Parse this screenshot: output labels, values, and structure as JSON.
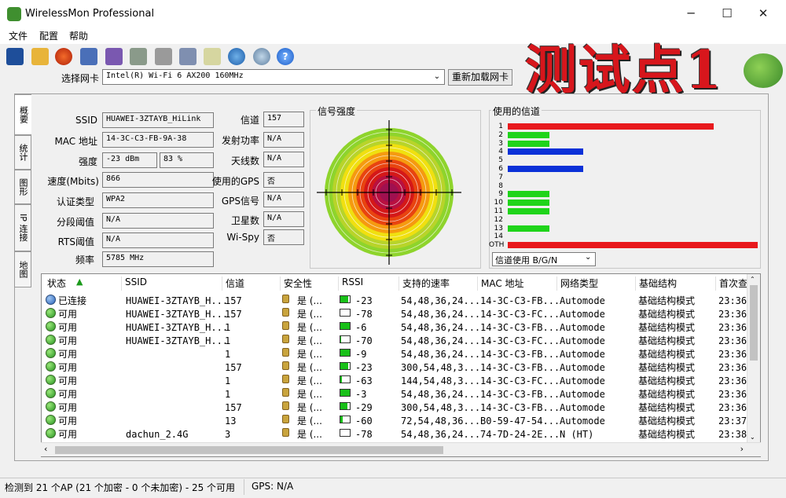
{
  "window": {
    "title": "WirelessMon Professional",
    "minimize": "─",
    "maximize": "☐",
    "close": "✕"
  },
  "menu": [
    "文件",
    "配置",
    "帮助"
  ],
  "toolbar_icons": [
    "save-icon",
    "open-folder-icon",
    "record-icon",
    "network-icon",
    "network-alt-icon",
    "export-icon",
    "print-icon",
    "settings-icon",
    "clipboard-icon",
    "globe-icon",
    "connect-icon",
    "help-icon"
  ],
  "nic": {
    "label": "选择网卡",
    "value": "Intel(R) Wi-Fi 6 AX200 160MHz",
    "reload": "重新加载网卡"
  },
  "overlay_title": "测试点1",
  "side_tabs": [
    "概要",
    "统计",
    "图形",
    "IP 连接",
    "地图"
  ],
  "fields": {
    "ssid": {
      "label": "SSID",
      "value": "HUAWEI-3ZTAYB_HiLink"
    },
    "mac": {
      "label": "MAC 地址",
      "value": "14-3C-C3-FB-9A-38"
    },
    "strength": {
      "label": "强度",
      "value": "-23 dBm",
      "pct": "83 %"
    },
    "speed": {
      "label": "速度(Mbits)",
      "value": "866"
    },
    "auth": {
      "label": "认证类型",
      "value": "WPA2"
    },
    "frag": {
      "label": "分段阈值",
      "value": "N/A"
    },
    "rts": {
      "label": "RTS阈值",
      "value": "N/A"
    },
    "freq": {
      "label": "频率",
      "value": "5785 MHz"
    },
    "channel": {
      "label": "信道",
      "value": "157"
    },
    "txpower": {
      "label": "发射功率",
      "value": "N/A"
    },
    "antennas": {
      "label": "天线数",
      "value": "N/A"
    },
    "use_gps": {
      "label": "使用的GPS",
      "value": "否"
    },
    "gps_signal": {
      "label": "GPS信号",
      "value": "N/A"
    },
    "satellites": {
      "label": "卫星数",
      "value": "N/A"
    },
    "wispy": {
      "label": "Wi-Spy",
      "value": "否"
    }
  },
  "signal": {
    "title": "信号强度"
  },
  "channels": {
    "title": "使用的信道",
    "labels": [
      "1",
      "2",
      "3",
      "4",
      "5",
      "6",
      "7",
      "8",
      "9",
      "10",
      "11",
      "12",
      "13",
      "14",
      "OTH"
    ],
    "usage": [
      5,
      1,
      1,
      2,
      0,
      2,
      0,
      0,
      1,
      1,
      1,
      0,
      1,
      0,
      6
    ],
    "colors": [
      "#e8191d",
      "#1fd41a",
      "#1fd41a",
      "#0b31d8",
      "#ffffff",
      "#0b31d8",
      "#ffffff",
      "#ffffff",
      "#1fd41a",
      "#1fd41a",
      "#1fd41a",
      "#ffffff",
      "#1fd41a",
      "#ffffff",
      "#e8191d"
    ],
    "select": "信道使用 B/G/N"
  },
  "table": {
    "headers": [
      "状态",
      "SSID",
      "信道",
      "安全性",
      "RSSI",
      "支持的速率",
      "MAC 地址",
      "网络类型",
      "基础结构",
      "首次查"
    ],
    "rows": [
      {
        "status": "已连接",
        "ssid": "HUAWEI-3ZTAYB_H...",
        "channel": "157",
        "sec": "是 (...",
        "rssi": "-23",
        "fill": 0.83,
        "rates": "54,48,36,24...",
        "mac": "14-3C-C3-FB...",
        "type": "Automode",
        "infra": "基础结构模式",
        "first": "23:36:"
      },
      {
        "status": "可用",
        "ssid": "HUAWEI-3ZTAYB_H...",
        "channel": "157",
        "sec": "是 (...",
        "rssi": "-78",
        "fill": 0,
        "rates": "54,48,36,24...",
        "mac": "14-3C-C3-FC...",
        "type": "Automode",
        "infra": "基础结构模式",
        "first": "23:36:"
      },
      {
        "status": "可用",
        "ssid": "HUAWEI-3ZTAYB_H...",
        "channel": "1",
        "sec": "是 (...",
        "rssi": "-6",
        "fill": 1,
        "rates": "54,48,36,24...",
        "mac": "14-3C-C3-FB...",
        "type": "Automode",
        "infra": "基础结构模式",
        "first": "23:36:"
      },
      {
        "status": "可用",
        "ssid": "HUAWEI-3ZTAYB_H...",
        "channel": "1",
        "sec": "是 (...",
        "rssi": "-70",
        "fill": 0.1,
        "rates": "54,48,36,24...",
        "mac": "14-3C-C3-FC...",
        "type": "Automode",
        "infra": "基础结构模式",
        "first": "23:36:"
      },
      {
        "status": "可用",
        "ssid": "",
        "channel": "1",
        "sec": "是 (...",
        "rssi": "-9",
        "fill": 1,
        "rates": "54,48,36,24...",
        "mac": "14-3C-C3-FB...",
        "type": "Automode",
        "infra": "基础结构模式",
        "first": "23:36:"
      },
      {
        "status": "可用",
        "ssid": "",
        "channel": "157",
        "sec": "是 (...",
        "rssi": "-23",
        "fill": 0.83,
        "rates": "300,54,48,3...",
        "mac": "14-3C-C3-FB...",
        "type": "Automode",
        "infra": "基础结构模式",
        "first": "23:36:"
      },
      {
        "status": "可用",
        "ssid": "",
        "channel": "1",
        "sec": "是 (...",
        "rssi": "-63",
        "fill": 0.2,
        "rates": "144,54,48,3...",
        "mac": "14-3C-C3-FC...",
        "type": "Automode",
        "infra": "基础结构模式",
        "first": "23:36:"
      },
      {
        "status": "可用",
        "ssid": "",
        "channel": "1",
        "sec": "是 (...",
        "rssi": "-3",
        "fill": 1,
        "rates": "54,48,36,24...",
        "mac": "14-3C-C3-FB...",
        "type": "Automode",
        "infra": "基础结构模式",
        "first": "23:36:"
      },
      {
        "status": "可用",
        "ssid": "",
        "channel": "157",
        "sec": "是 (...",
        "rssi": "-29",
        "fill": 0.75,
        "rates": "300,54,48,3...",
        "mac": "14-3C-C3-FB...",
        "type": "Automode",
        "infra": "基础结构模式",
        "first": "23:36:"
      },
      {
        "status": "可用",
        "ssid": "",
        "channel": "13",
        "sec": "是 (...",
        "rssi": "-60",
        "fill": 0.25,
        "rates": "72,54,48,36...",
        "mac": "B0-59-47-54...",
        "type": "Automode",
        "infra": "基础结构模式",
        "first": "23:37:"
      },
      {
        "status": "可用",
        "ssid": "dachun_2.4G",
        "channel": "3",
        "sec": "是 (...",
        "rssi": "-78",
        "fill": 0,
        "rates": "54,48,36,24...",
        "mac": "74-7D-24-2E...",
        "type": "N (HT)",
        "infra": "基础结构模式",
        "first": "23:38:"
      }
    ]
  },
  "status": {
    "ap_text": "检测到 21 个AP (21 个加密 - 0 个未加密) - 25 个可用",
    "gps": "GPS: N/A"
  }
}
